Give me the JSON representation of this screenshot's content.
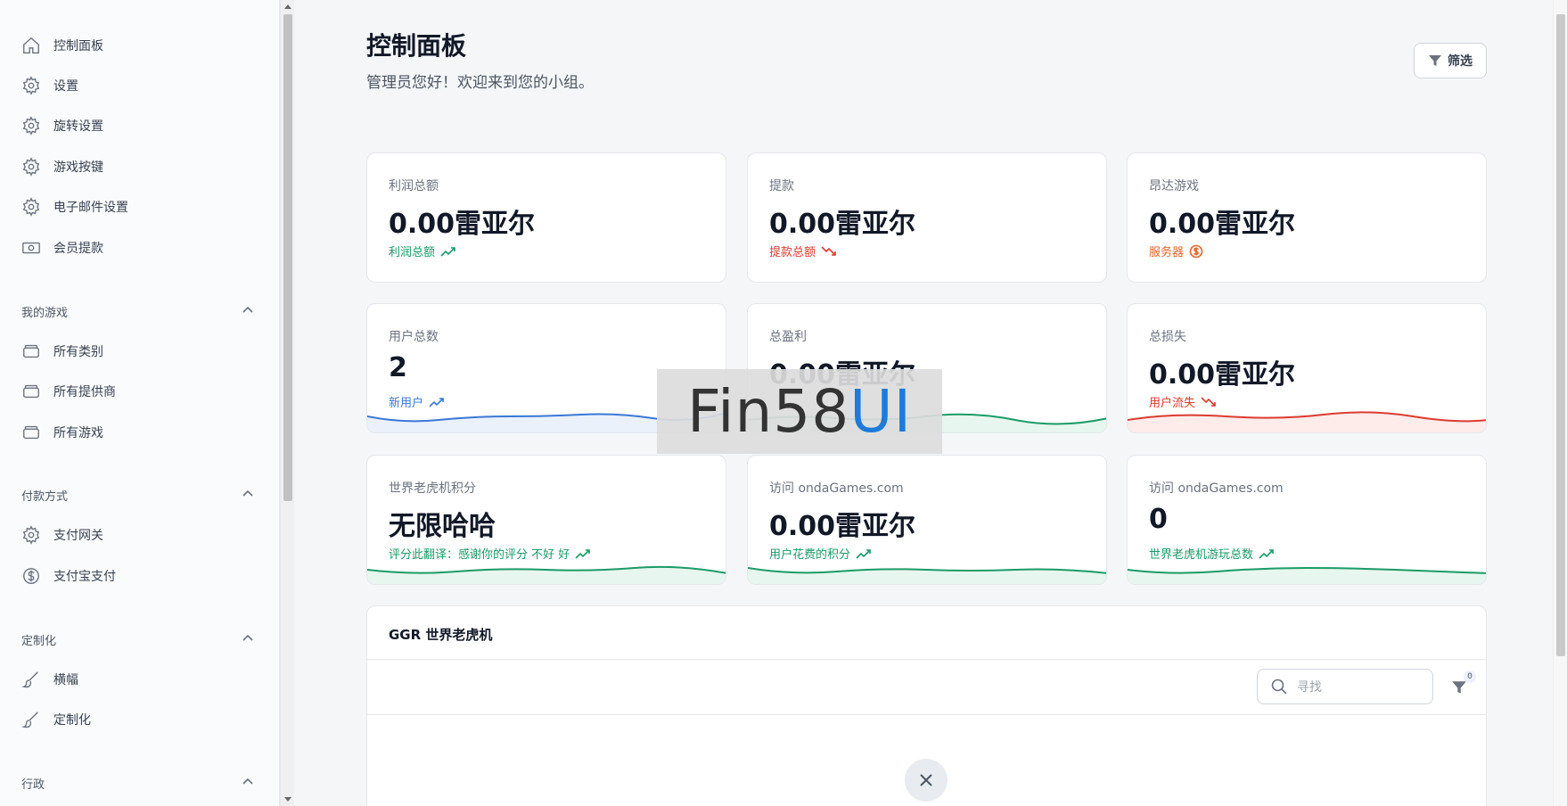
{
  "sidebar": {
    "items": [
      {
        "label": "控制面板",
        "icon": "home-icon"
      },
      {
        "label": "设置",
        "icon": "gear-icon"
      },
      {
        "label": "旋转设置",
        "icon": "gear-icon"
      },
      {
        "label": "游戏按键",
        "icon": "gear-icon"
      },
      {
        "label": "电子邮件设置",
        "icon": "gear-icon"
      },
      {
        "label": "会员提款",
        "icon": "cash-icon"
      }
    ],
    "sections": [
      {
        "title": "我的游戏",
        "items": [
          {
            "label": "所有类别",
            "icon": "stack-icon"
          },
          {
            "label": "所有提供商",
            "icon": "stack-icon"
          },
          {
            "label": "所有游戏",
            "icon": "stack-icon"
          }
        ]
      },
      {
        "title": "付款方式",
        "items": [
          {
            "label": "支付网关",
            "icon": "gear-icon"
          },
          {
            "label": "支付宝支付",
            "icon": "dollar-circle-icon"
          }
        ]
      },
      {
        "title": "定制化",
        "items": [
          {
            "label": "横幅",
            "icon": "brush-icon"
          },
          {
            "label": "定制化",
            "icon": "brush-icon"
          }
        ]
      },
      {
        "title": "行政",
        "items": []
      }
    ]
  },
  "header": {
    "title": "控制面板",
    "subtitle": "管理员您好！欢迎来到您的小组。",
    "filter_label": "筛选"
  },
  "cards": [
    {
      "label": "利润总额",
      "value": "0.00雷亚尔",
      "trend": "利润总额",
      "color": "#1a9b67",
      "trend_icon": "trending-up-icon"
    },
    {
      "label": "提款",
      "value": "0.00雷亚尔",
      "trend": "提款总额",
      "color": "#dc3b30",
      "trend_icon": "trending-down-icon"
    },
    {
      "label": "昂达游戏",
      "value": "0.00雷亚尔",
      "trend": "服务器",
      "color": "#e2662b",
      "trend_icon": "dollar-circle-icon"
    },
    {
      "label": "用户总数",
      "value": "2",
      "trend": "新用户",
      "color": "#3a78d6",
      "trend_icon": "trending-up-icon"
    },
    {
      "label": "总盈利",
      "value": "0.00雷亚尔",
      "trend": "",
      "color": "#1a9b67",
      "trend_icon": ""
    },
    {
      "label": "总损失",
      "value": "0.00雷亚尔",
      "trend": "用户流失",
      "color": "#dc3b30",
      "trend_icon": "trending-down-icon"
    },
    {
      "label": "世界老虎机积分",
      "value": "无限哈哈",
      "trend": "评分此翻译：感谢你的评分 不好 好",
      "color": "#1a9b67",
      "trend_icon": "trending-up-icon"
    },
    {
      "label": "访问 ondaGames.com",
      "value": "0.00雷亚尔",
      "trend": "用户花费的积分",
      "color": "#1a9b67",
      "trend_icon": "trending-up-icon"
    },
    {
      "label": "访问 ondaGames.com",
      "value": "0",
      "trend": "世界老虎机游玩总数",
      "color": "#1a9b67",
      "trend_icon": "trending-up-icon"
    }
  ],
  "table": {
    "title": "GGR 世界老虎机",
    "search_placeholder": "寻找",
    "filter_count": "0"
  },
  "watermark": {
    "part1": "Fin58",
    "part2": "UI"
  }
}
